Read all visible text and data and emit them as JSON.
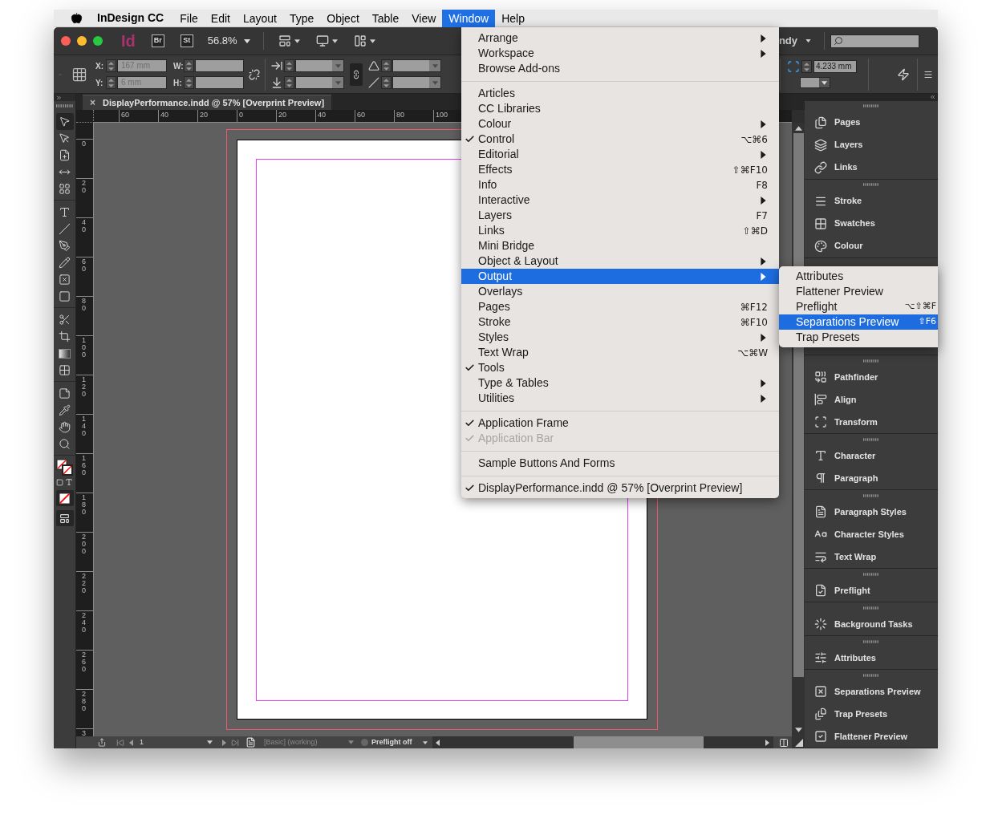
{
  "menu_bar": {
    "app_name": "InDesign CC",
    "menus": [
      {
        "label": "File",
        "selected": false
      },
      {
        "label": "Edit",
        "selected": false
      },
      {
        "label": "Layout",
        "selected": false
      },
      {
        "label": "Type",
        "selected": false
      },
      {
        "label": "Object",
        "selected": false
      },
      {
        "label": "Table",
        "selected": false
      },
      {
        "label": "View",
        "selected": false
      },
      {
        "label": "Window",
        "selected": true
      },
      {
        "label": "Help",
        "selected": false
      }
    ]
  },
  "app_bar": {
    "logo": "Id",
    "bridge": "Br",
    "stock": "St",
    "zoom": "56.8%",
    "user": "ndy"
  },
  "control_panel": {
    "x_label": "X:",
    "x_value": "167 mm",
    "y_label": "Y:",
    "y_value": "6 mm",
    "w_label": "W:",
    "h_label": "H:",
    "stroke_weight": "4.233 mm"
  },
  "document_tab": {
    "close": "×",
    "title": "DisplayPerformance.indd @ 57% [Overprint Preview]"
  },
  "rulers": {
    "horizontal": [
      "60",
      "40",
      "20",
      "0",
      "20",
      "40",
      "60",
      "80",
      "100"
    ],
    "vertical": [
      "0",
      "20",
      "40",
      "60",
      "80",
      "100",
      "120",
      "140",
      "160",
      "180",
      "200",
      "220",
      "240",
      "260",
      "280",
      "3"
    ]
  },
  "status_bar": {
    "page": "1",
    "master": "[Basic] (working)",
    "preflight": "Preflight off"
  },
  "dock": {
    "groups": [
      {
        "items": [
          "Pages",
          "Layers",
          "Links"
        ]
      },
      {
        "items": [
          "Stroke",
          "Swatches",
          "Colour"
        ]
      },
      {
        "items": [
          "Pathfinder",
          "Align",
          "Transform"
        ]
      },
      {
        "items": [
          "Character",
          "Paragraph"
        ]
      },
      {
        "items": [
          "Paragraph Styles",
          "Character Styles",
          "Text Wrap"
        ]
      },
      {
        "items": [
          "Preflight"
        ]
      },
      {
        "items": [
          "Background Tasks"
        ]
      },
      {
        "items": [
          "Attributes"
        ]
      },
      {
        "items": [
          "Separations Preview",
          "Trap Presets",
          "Flattener Preview"
        ]
      }
    ]
  },
  "window_menu": {
    "groups": [
      {
        "items": [
          {
            "label": "Arrange",
            "submenu": true,
            "checked": false,
            "disabled": false,
            "selected": false
          },
          {
            "label": "Workspace",
            "submenu": true,
            "checked": false,
            "disabled": false,
            "selected": false
          },
          {
            "label": "Browse Add-ons",
            "submenu": false,
            "checked": false,
            "disabled": false,
            "selected": false
          }
        ]
      },
      {
        "items": [
          {
            "label": "Articles",
            "submenu": false,
            "checked": false,
            "disabled": false,
            "selected": false
          },
          {
            "label": "CC Libraries",
            "submenu": false,
            "checked": false,
            "disabled": false,
            "selected": false
          },
          {
            "label": "Colour",
            "submenu": true,
            "checked": false,
            "disabled": false,
            "selected": false
          },
          {
            "label": "Control",
            "shortcut": "⌥⌘6",
            "submenu": false,
            "checked": true,
            "disabled": false,
            "selected": false
          },
          {
            "label": "Editorial",
            "submenu": true,
            "checked": false,
            "disabled": false,
            "selected": false
          },
          {
            "label": "Effects",
            "shortcut": "⇧⌘F10",
            "submenu": false,
            "checked": false,
            "disabled": false,
            "selected": false
          },
          {
            "label": "Info",
            "shortcut": "F8",
            "submenu": false,
            "checked": false,
            "disabled": false,
            "selected": false
          },
          {
            "label": "Interactive",
            "submenu": true,
            "checked": false,
            "disabled": false,
            "selected": false
          },
          {
            "label": "Layers",
            "shortcut": "F7",
            "submenu": false,
            "checked": false,
            "disabled": false,
            "selected": false
          },
          {
            "label": "Links",
            "shortcut": "⇧⌘D",
            "submenu": false,
            "checked": false,
            "disabled": false,
            "selected": false
          },
          {
            "label": "Mini Bridge",
            "submenu": false,
            "checked": false,
            "disabled": false,
            "selected": false
          },
          {
            "label": "Object & Layout",
            "submenu": true,
            "checked": false,
            "disabled": false,
            "selected": false
          },
          {
            "label": "Output",
            "submenu": true,
            "checked": false,
            "disabled": false,
            "selected": true
          },
          {
            "label": "Overlays",
            "submenu": false,
            "checked": false,
            "disabled": false,
            "selected": false
          },
          {
            "label": "Pages",
            "shortcut": "⌘F12",
            "submenu": false,
            "checked": false,
            "disabled": false,
            "selected": false
          },
          {
            "label": "Stroke",
            "shortcut": "⌘F10",
            "submenu": false,
            "checked": false,
            "disabled": false,
            "selected": false
          },
          {
            "label": "Styles",
            "submenu": true,
            "checked": false,
            "disabled": false,
            "selected": false
          },
          {
            "label": "Text Wrap",
            "shortcut": "⌥⌘W",
            "submenu": false,
            "checked": false,
            "disabled": false,
            "selected": false
          },
          {
            "label": "Tools",
            "submenu": false,
            "checked": true,
            "disabled": false,
            "selected": false
          },
          {
            "label": "Type & Tables",
            "submenu": true,
            "checked": false,
            "disabled": false,
            "selected": false
          },
          {
            "label": "Utilities",
            "submenu": true,
            "checked": false,
            "disabled": false,
            "selected": false
          }
        ]
      },
      {
        "items": [
          {
            "label": "Application Frame",
            "submenu": false,
            "checked": true,
            "disabled": false,
            "selected": false
          },
          {
            "label": "Application Bar",
            "submenu": false,
            "checked": true,
            "disabled": true,
            "selected": false
          }
        ]
      },
      {
        "items": [
          {
            "label": "Sample Buttons And Forms",
            "submenu": false,
            "checked": false,
            "disabled": false,
            "selected": false
          }
        ]
      },
      {
        "items": [
          {
            "label": "DisplayPerformance.indd @ 57% [Overprint Preview]",
            "submenu": false,
            "checked": true,
            "disabled": false,
            "selected": false
          }
        ]
      }
    ]
  },
  "output_submenu": {
    "items": [
      {
        "label": "Attributes",
        "selected": false
      },
      {
        "label": "Flattener Preview",
        "selected": false
      },
      {
        "label": "Preflight",
        "shortcut": "⌥⇧⌘F",
        "selected": false
      },
      {
        "label": "Separations Preview",
        "shortcut": "⇧F6",
        "selected": true
      },
      {
        "label": "Trap Presets",
        "selected": false
      }
    ]
  }
}
